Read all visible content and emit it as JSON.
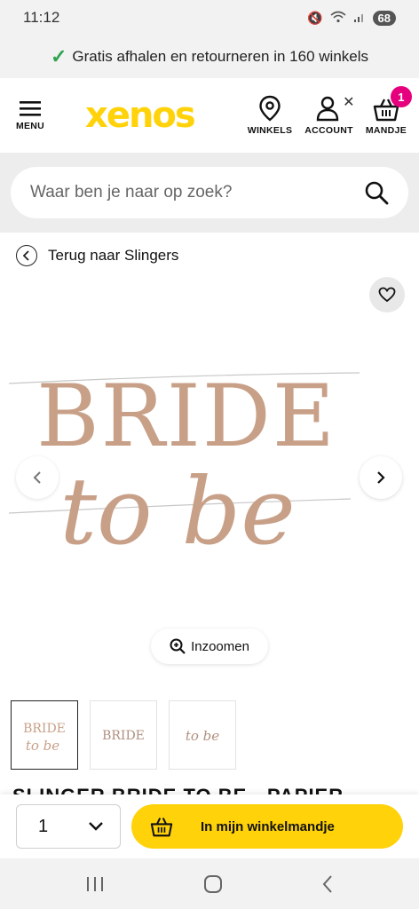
{
  "status_bar": {
    "time": "11:12",
    "battery": "68"
  },
  "promo": {
    "text": "Gratis afhalen en retourneren in 160 winkels"
  },
  "header": {
    "menu_label": "MENU",
    "logo_text": "xenos",
    "stores_label": "WINKELS",
    "account_label": "ACCOUNT",
    "cart_label": "MANDJE",
    "cart_count": "1"
  },
  "search": {
    "placeholder": "Waar ben je naar op zoek?"
  },
  "breadcrumb": {
    "back_label": "Terug naar Slingers"
  },
  "product": {
    "banner_line1": "BRIDE",
    "banner_line2": "to be",
    "zoom_label": "Inzoomen",
    "thumbnails": [
      {
        "line1": "BRIDE",
        "line2": "to be"
      },
      {
        "line1": "BRIDE",
        "line2": ""
      },
      {
        "line1": "",
        "line2": "to be"
      }
    ],
    "title_partial": "SLINGER BRIDE TO BE - PAPIER"
  },
  "purchase": {
    "quantity": "1",
    "add_to_cart_label": "In mijn winkelmandje"
  },
  "colors": {
    "brand_yellow": "#ffd20a",
    "badge_pink": "#e6007e",
    "rose_gold": "#c8a088"
  },
  "icons": [
    "hamburger-icon",
    "location-pin-icon",
    "user-icon",
    "basket-icon",
    "search-icon",
    "chevron-left-icon",
    "heart-icon",
    "chevron-right-icon",
    "zoom-in-icon",
    "chevron-down-icon",
    "recent-apps-icon",
    "home-icon",
    "back-icon"
  ]
}
